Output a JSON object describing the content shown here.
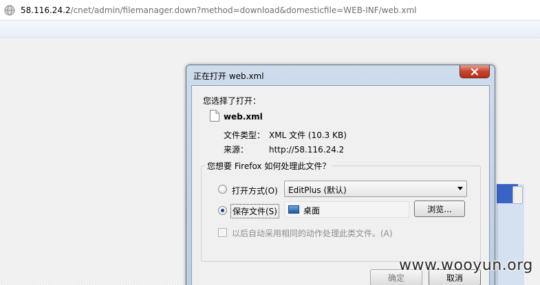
{
  "address_bar": {
    "host": "58.116.24.2",
    "path": "/cnet/admin/filemanager.down?method=download&domesticfile=WEB-INF/web.xml",
    "icon": "globe-icon"
  },
  "dialog": {
    "title": "正在打开 web.xml",
    "chosen_label": "您选择了打开：",
    "file_name": "web.xml",
    "type_label": "文件类型：",
    "type_value": "XML 文件 (10.3 KB)",
    "from_label": "来源：",
    "from_value": "http://58.116.24.2",
    "question": "您想要 Firefox 如何处理此文件？",
    "open_with_label": "打开方式(O)",
    "open_with_app": "EditPlus (默认)",
    "save_label": "保存文件(S)",
    "save_folder": "桌面",
    "browse_label": "浏览...",
    "remember_label": "以后自动采用相同的动作处理此类文件。(A)",
    "ok_label": "确定",
    "cancel_label": "取消",
    "selected_action": "save",
    "remember_checked": false
  },
  "watermark": "www.wooyun.org",
  "colors": {
    "dialog_frame": "#bccde3",
    "close_button": "#c7432c",
    "client_bg": "#f0f0f0"
  }
}
